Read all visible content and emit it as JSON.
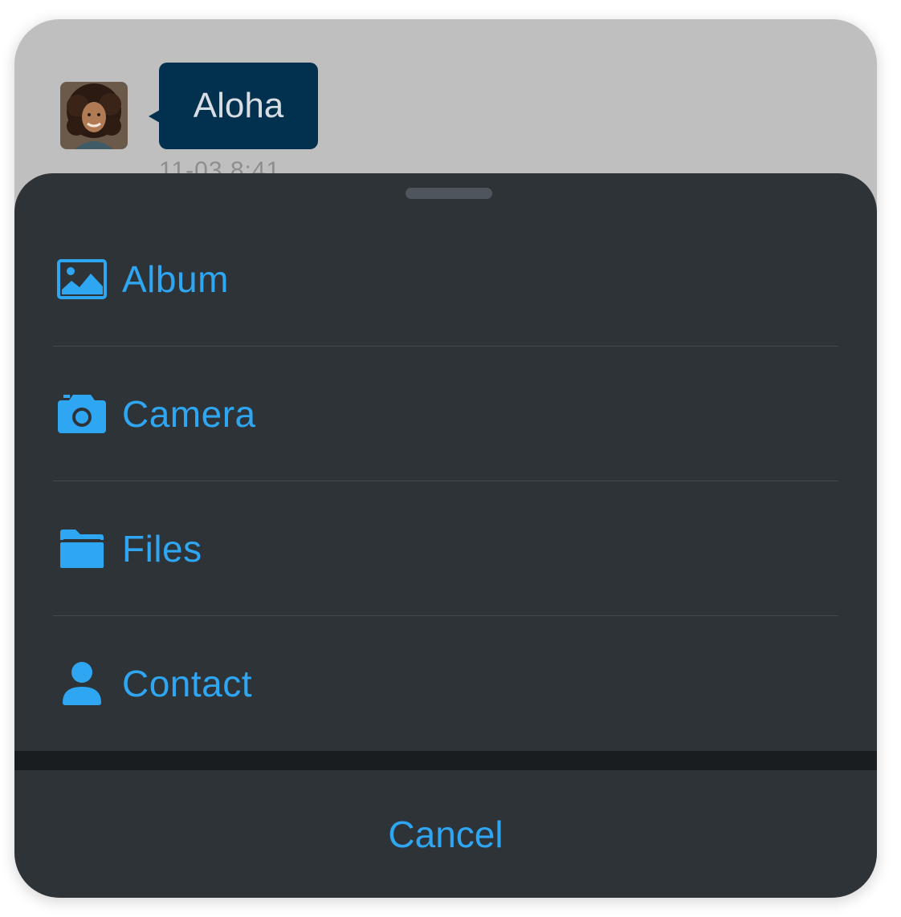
{
  "colors": {
    "chat_background": "#bfbfbf",
    "bubble_background": "#02314f",
    "sheet_background": "#2e3337",
    "band_background": "#1a1d20",
    "accent": "#2ea6f2",
    "grabber": "#4e555d"
  },
  "chat": {
    "message_text": "Aloha",
    "timestamp": "11-03  8:41",
    "avatar_icon": "user-photo"
  },
  "sheet": {
    "items": [
      {
        "label": "Album",
        "icon": "image-icon"
      },
      {
        "label": "Camera",
        "icon": "camera-icon"
      },
      {
        "label": "Files",
        "icon": "folder-icon"
      },
      {
        "label": "Contact",
        "icon": "person-icon"
      }
    ],
    "cancel_label": "Cancel"
  }
}
